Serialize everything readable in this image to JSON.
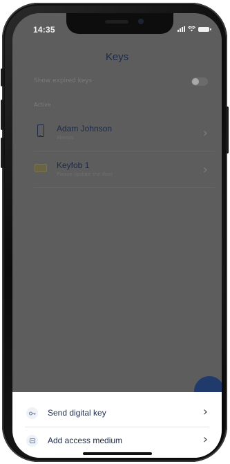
{
  "status_bar": {
    "time": "14:35"
  },
  "header": {
    "title": "Keys"
  },
  "settings": {
    "show_expired_label": "Show expired keys",
    "show_expired_on": false
  },
  "section": {
    "label": "Active"
  },
  "keys": [
    {
      "name": "Adam Johnson",
      "subtitle": "Always",
      "icon": "smartphone-icon"
    },
    {
      "name": "Keyfob 1",
      "subtitle": "Please update the door",
      "icon": "keyfob-icon"
    }
  ],
  "bottom_sheet": {
    "items": [
      {
        "label": "Send digital key",
        "icon": "key-icon"
      },
      {
        "label": "Add access medium",
        "icon": "access-medium-icon"
      }
    ]
  },
  "colors": {
    "accent": "#1d2a4a",
    "overlay": "#5d5d5d",
    "fab": "#1f3a6b"
  }
}
